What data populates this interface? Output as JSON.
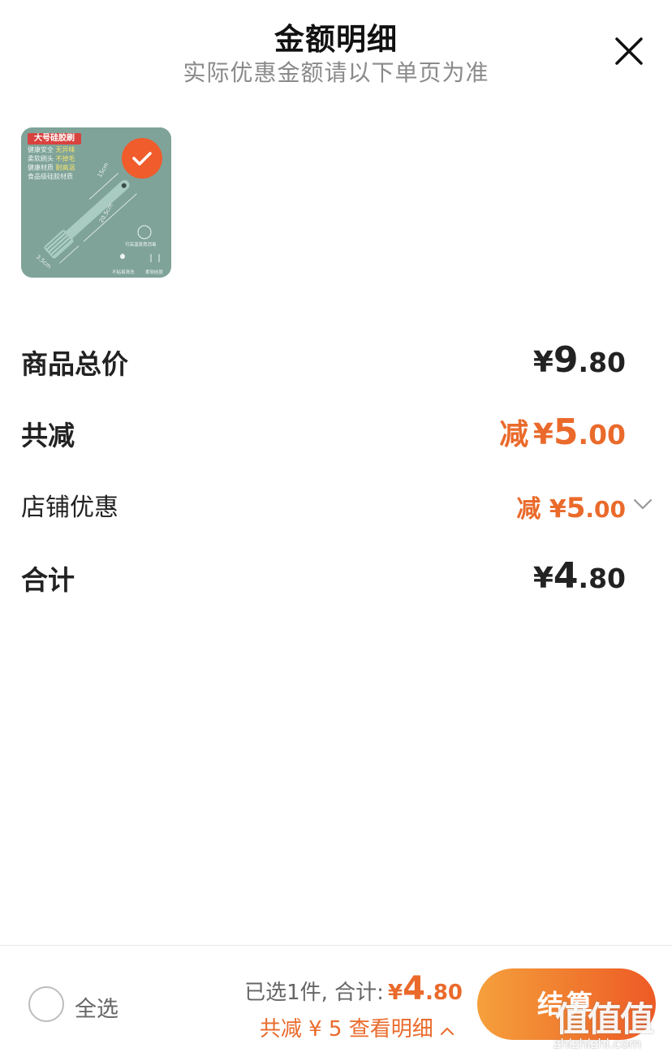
{
  "header": {
    "title": "金额明细",
    "subtitle": "实际优惠金额请以下单页为准",
    "close_icon": "close-icon"
  },
  "product": {
    "tag": "大号硅胶刷",
    "features": [
      {
        "label": "健康安全",
        "highlight": "无异味"
      },
      {
        "label": "柔软刷头",
        "highlight": "不掉毛"
      },
      {
        "label": "健康材质",
        "highlight": "耐高温"
      },
      {
        "label": "食品级硅胶材质",
        "highlight": ""
      }
    ],
    "dim_handle": "15cm",
    "dim_total": "20.5cm",
    "dim_head": "3.5cm",
    "note_heat": "可高温蒸煮消毒",
    "note_oil": "不粘易清洗",
    "note_soft": "柔软硅胶",
    "selected": true,
    "check_icon": "check-icon"
  },
  "rows": {
    "goods_total": {
      "label": "商品总价",
      "yen": "¥",
      "int": "9",
      "dec": ".80"
    },
    "total_discount": {
      "label": "共减",
      "prefix": "减",
      "yen": "¥",
      "int": "5",
      "dec": ".00"
    },
    "store_discount": {
      "label": "店铺优惠",
      "prefix": "减",
      "yen": "¥",
      "int": "5",
      "dec": ".00"
    },
    "total": {
      "label": "合计",
      "yen": "¥",
      "int": "4",
      "dec": ".80"
    }
  },
  "bottom": {
    "select_all": "全选",
    "selected_text": "已选1件, 合计:",
    "yen": "¥",
    "int": "4",
    "dec": ".80",
    "discount_link": "共减 ¥ 5  查看明细",
    "checkout": "结算"
  },
  "watermark": {
    "logo": "值值值",
    "text": "zhizhizhi.com"
  },
  "colors": {
    "accent": "#ea6a2b",
    "badge": "#f05c2c",
    "product_bg": "#7fa399"
  }
}
